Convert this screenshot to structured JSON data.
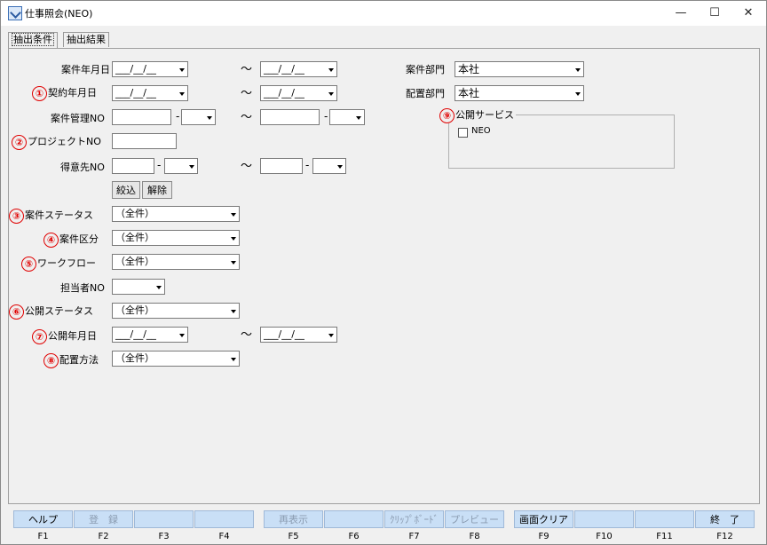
{
  "window": {
    "title": "仕事照会(NEO)",
    "minimize": "—",
    "maximize": "☐",
    "close": "✕"
  },
  "tabs": [
    {
      "label": "抽出条件",
      "active": true
    },
    {
      "label": "抽出結果",
      "active": false
    }
  ],
  "markers": [
    "①",
    "②",
    "③",
    "④",
    "⑤",
    "⑥",
    "⑦",
    "⑧",
    "⑨"
  ],
  "form": {
    "anken_date": {
      "label": "案件年月日",
      "from": "___/__/__",
      "to": "___/__/__"
    },
    "keiyaku_date": {
      "label": "契約年月日",
      "from": "___/__/__",
      "to": "___/__/__"
    },
    "anken_kanri": {
      "label": "案件管理NO",
      "dash": "-"
    },
    "project_no": {
      "label": "プロジェクトNO"
    },
    "tokuisaki": {
      "label": "得意先NO",
      "dash": "-"
    },
    "tilde": "～",
    "filter_button": "絞込",
    "clear_button": "解除",
    "anken_status": {
      "label": "案件ステータス",
      "value": "（全件）"
    },
    "anken_kubun": {
      "label": "案件区分",
      "value": "（全件）"
    },
    "workflow": {
      "label": "ワークフロー",
      "value": "（全件）"
    },
    "tantousha": {
      "label": "担当者NO"
    },
    "kokai_status": {
      "label": "公開ステータス",
      "value": "（全件）"
    },
    "kokai_date": {
      "label": "公開年月日",
      "from": "___/__/__",
      "to": "___/__/__"
    },
    "haichi_houhou": {
      "label": "配置方法",
      "value": "（全件）"
    },
    "anken_bumon": {
      "label": "案件部門",
      "value": "本社"
    },
    "haichi_bumon": {
      "label": "配置部門",
      "value": "本社"
    },
    "kokai_service": {
      "label": "公開サービス",
      "checkbox_label": "NEO",
      "checked": false
    }
  },
  "fkeys": [
    {
      "label": "ヘルプ",
      "key": "F1",
      "enabled": true
    },
    {
      "label": "登　録",
      "key": "F2",
      "enabled": false
    },
    {
      "label": "",
      "key": "F3",
      "enabled": false
    },
    {
      "label": "",
      "key": "F4",
      "enabled": false
    },
    {
      "label": "再表示",
      "key": "F5",
      "enabled": false
    },
    {
      "label": "",
      "key": "F6",
      "enabled": false
    },
    {
      "label": "ｸﾘｯﾌﾟﾎﾞｰﾄﾞ",
      "key": "F7",
      "enabled": false
    },
    {
      "label": "プレビュー",
      "key": "F8",
      "enabled": false
    },
    {
      "label": "画面クリア",
      "key": "F9",
      "enabled": true
    },
    {
      "label": "",
      "key": "F10",
      "enabled": false
    },
    {
      "label": "",
      "key": "F11",
      "enabled": false
    },
    {
      "label": "終　了",
      "key": "F12",
      "enabled": true
    }
  ]
}
